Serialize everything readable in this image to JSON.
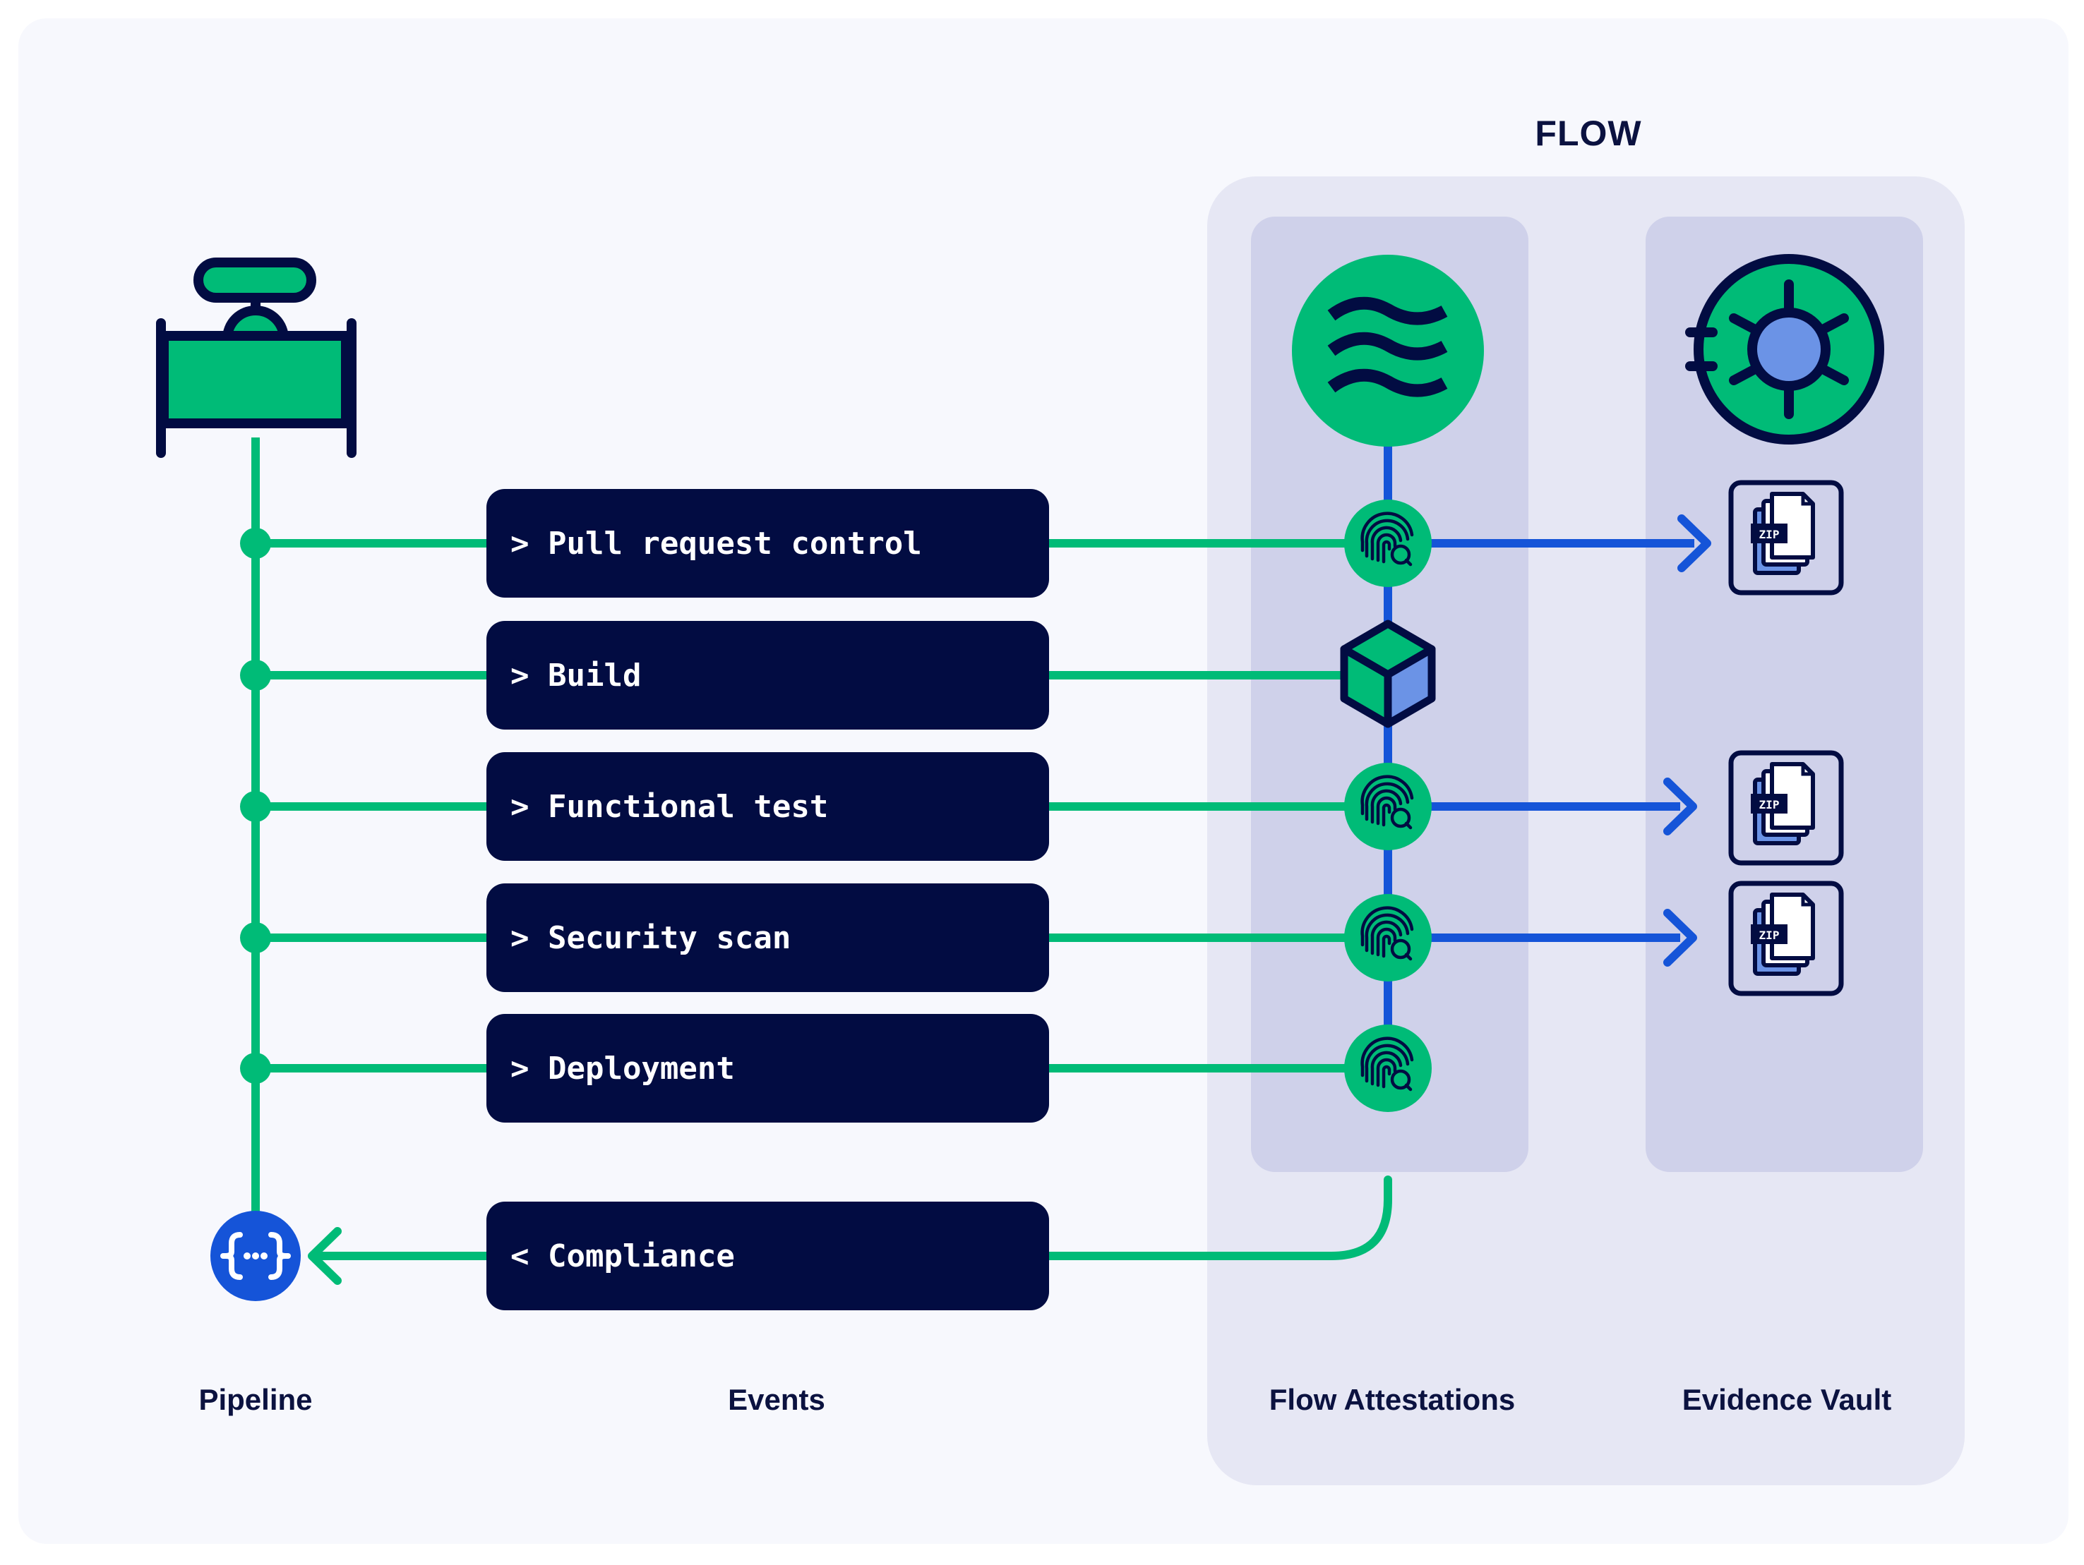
{
  "title": "FLOW",
  "colors": {
    "green": "#00bb77",
    "navy": "#020c42",
    "blue": "#1554d8",
    "light_blue": "#6b93e6",
    "panel": "#e6e7f4",
    "column": "#cfd1ea",
    "background": "#f7f8fd"
  },
  "pipeline": {
    "label": "Pipeline",
    "top_icon": "pipe-valve-icon",
    "bottom_icon": "curly-braces-api-icon"
  },
  "events": {
    "label": "Events",
    "items": [
      {
        "label": "> Pull request control",
        "attestation": "fingerprint-search-icon",
        "evidence": true
      },
      {
        "label": "> Build",
        "attestation": "cube-artifact-icon",
        "evidence": false
      },
      {
        "label": "> Functional test",
        "attestation": "fingerprint-search-icon",
        "evidence": true
      },
      {
        "label": "> Security scan",
        "attestation": "fingerprint-search-icon",
        "evidence": true
      },
      {
        "label": "> Deployment",
        "attestation": "fingerprint-search-icon",
        "evidence": false
      }
    ],
    "compliance": {
      "label": "< Compliance"
    }
  },
  "flow_attestations": {
    "label": "Flow Attestations",
    "top_icon": "waves-flow-icon"
  },
  "evidence_vault": {
    "label": "Evidence Vault",
    "top_icon": "vault-safe-icon",
    "file_badge": "ZIP"
  }
}
